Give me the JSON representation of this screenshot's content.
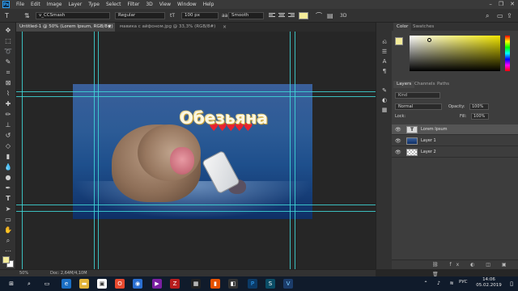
{
  "app": {
    "logo": "Ps",
    "menu": [
      "File",
      "Edit",
      "Image",
      "Layer",
      "Type",
      "Select",
      "Filter",
      "3D",
      "View",
      "Window",
      "Help"
    ],
    "window_controls": [
      "–",
      "❐",
      "✕"
    ]
  },
  "options": {
    "font_family": "v_CCSmash",
    "font_style": "Regular",
    "font_size": "100 px",
    "antialias": "Smooth",
    "text_color": "#f4ec9a"
  },
  "tabs": [
    {
      "label": "Untitled-1 @ 50% (Lorem Ipsum, RGB/8#) *",
      "active": true
    },
    {
      "label": "мавика с айфоном.jpg @ 33,3% (RGB/8#)",
      "active": false
    }
  ],
  "canvas": {
    "title_text": "Обезьяна",
    "hearts": "♥♥♥♥♥"
  },
  "panels": {
    "color_tabs": [
      "Color",
      "Swatches"
    ],
    "layers_tabs": [
      "Layers",
      "Channels",
      "Paths"
    ],
    "kind_filter": "Kind",
    "blend_mode": "Normal",
    "opacity_label": "Opacity:",
    "opacity_value": "100%",
    "lock_label": "Lock:",
    "fill_label": "Fill:",
    "fill_value": "100%",
    "layers": [
      {
        "name": "Lorem Ipsum",
        "thumb": "T",
        "selected": true
      },
      {
        "name": "Layer 1",
        "thumb": "",
        "selected": false
      },
      {
        "name": "Layer 2",
        "thumb": "",
        "selected": false
      }
    ],
    "footer_icons": "⛓ fx ◐ ◫ ▣ 🗑"
  },
  "status": {
    "zoom": "50%",
    "doc": "Doc: 2,64M/4,10M"
  },
  "taskbar": {
    "lang": "РУС",
    "time": "14:06",
    "date": "05.02.2019"
  },
  "colors": {
    "accent": "#31a8ff",
    "guide": "#3fd8d8",
    "foreground": "#f4ec9a"
  }
}
